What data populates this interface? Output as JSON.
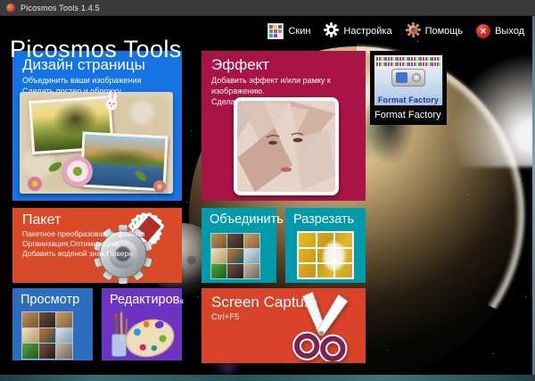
{
  "window": {
    "title": "Picosmos Tools 1.4.5"
  },
  "header": {
    "app_title": "Picosmos Tools",
    "buttons": {
      "skin": {
        "label": "Скин",
        "icon": "color-grid-icon"
      },
      "settings": {
        "label": "Настройка",
        "icon": "gear-icon"
      },
      "help": {
        "label": "Помощь",
        "icon": "colored-gear-icon"
      },
      "exit": {
        "label": "Выход",
        "icon": "circle-x-icon",
        "glyph": "✕"
      }
    }
  },
  "tiles": {
    "design": {
      "title": "Дизайн страницы",
      "line1": "Объединить ваши изображения",
      "line2": "Сделать постер и обложку",
      "color": "#1574e4",
      "art": "scrapbook-collage"
    },
    "effect": {
      "title": "Эффект",
      "line1": "Добавить эффект и/или рамку к изображению.",
      "line2": "Сделать изображения ярче.",
      "color": "#a91345",
      "art": "kaleidoscope-face-photo"
    },
    "batch": {
      "title": "Пакет",
      "line1": "Пакетное преобразование файлов",
      "line2": "Организация,Оптимизация,",
      "line3": "Добавить водяной знак,Поверн",
      "color": "#d84a28",
      "art": "gear-with-photos"
    },
    "combine": {
      "title": "Объединить",
      "color": "#009aab",
      "art": "photo-grid-3x3"
    },
    "split": {
      "title": "Разрезать",
      "color": "#009aab",
      "art": "sliced-photo-3x3"
    },
    "view": {
      "title": "Просмотр",
      "color": "#2e6cc0",
      "art": "photo-grid-3x3"
    },
    "edit": {
      "title": "Редактиров",
      "suffix": "а",
      "color": "#6d34c4",
      "art": "paint-palette"
    },
    "screen_capture": {
      "title": "Screen Capture",
      "shortcut": "Ctrl+F5",
      "color": "#d8432a",
      "art": "scissors"
    }
  },
  "promo": {
    "thumb_caption": "Format Factory",
    "label": "Format Factory"
  },
  "background": {
    "scene": "earth-from-space",
    "base_color": "#000000"
  }
}
